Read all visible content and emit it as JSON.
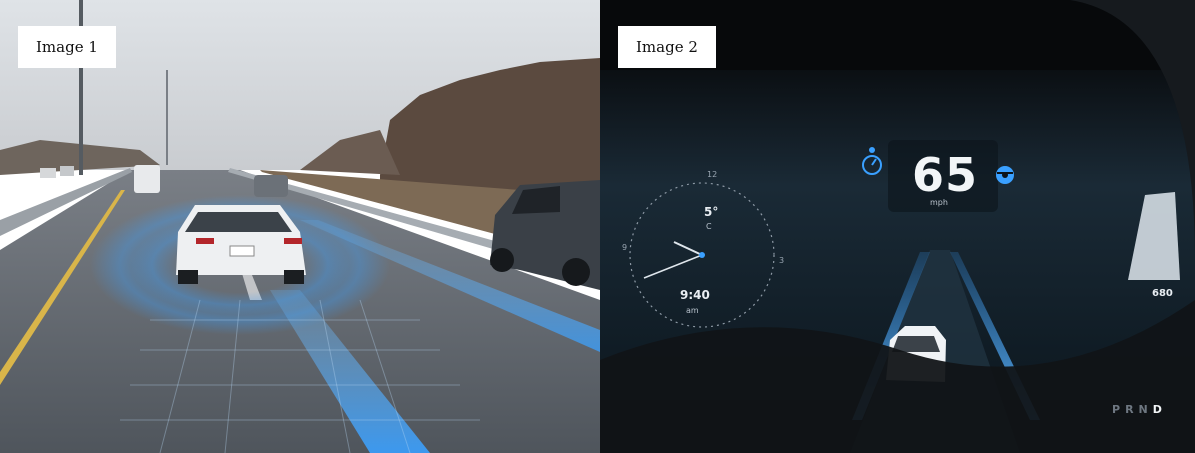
{
  "images": [
    {
      "caption": "Image 1"
    },
    {
      "caption": "Image 2",
      "dashboard": {
        "speed": "65",
        "speed_unit": "mph",
        "temperature": "5°",
        "temperature_unit": "C",
        "clock_time": "9:40",
        "clock_period": "am",
        "clock_ticks": [
          "12",
          "3",
          "9"
        ],
        "range": "680",
        "gears": [
          "P",
          "R",
          "N",
          "D"
        ],
        "active_gear": "D",
        "icons": [
          "steering-wheel-icon",
          "speed-limit-icon"
        ]
      }
    }
  ],
  "colors": {
    "lane_glow": "#3aa0ff",
    "dashboard_bg": "#0f1a24",
    "road_gray": "#5a6068"
  }
}
